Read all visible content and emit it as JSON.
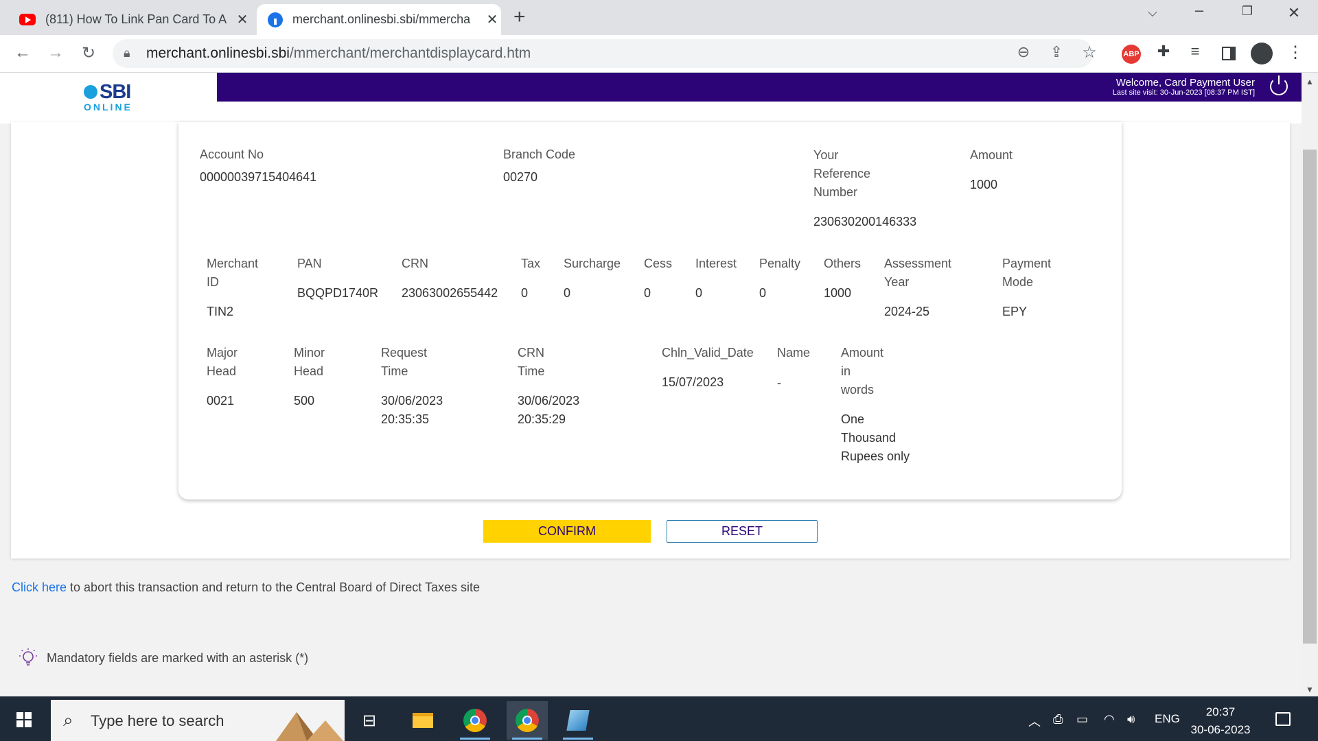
{
  "browser": {
    "tabs": [
      {
        "title": "(811) How To Link Pan Card To A",
        "active": false,
        "icon": "youtube-icon"
      },
      {
        "title": "merchant.onlinesbi.sbi/mmercha",
        "active": true,
        "icon": "sbi-favicon-icon"
      }
    ],
    "new_tab": "+",
    "url_host": "merchant.onlinesbi.sbi",
    "url_path": "/mmerchant/merchantdisplaycard.htm"
  },
  "header": {
    "logo_text": "SBI",
    "logo_sub": "ONLINE",
    "welcome": "Welcome, Card Payment User",
    "last_visit": "Last site visit: 30-Jun-2023 [08:37 PM IST]"
  },
  "details": {
    "account_no_label": "Account No",
    "account_no": "00000039715404641",
    "branch_code_label": "Branch Code",
    "branch_code": "00270",
    "reference_label_1": "Your",
    "reference_label_2": "Reference",
    "reference_label_3": "Number",
    "reference_number": "230630200146333",
    "amount_label": "Amount",
    "amount": "1000"
  },
  "row2": {
    "merchant_id_label_1": "Merchant",
    "merchant_id_label_2": "ID",
    "merchant_id": "TIN2",
    "pan_label": "PAN",
    "pan": "BQQPD1740R",
    "crn_label": "CRN",
    "crn": "23063002655442",
    "tax_label": "Tax",
    "tax": "0",
    "surcharge_label": "Surcharge",
    "surcharge": "0",
    "cess_label": "Cess",
    "cess": "0",
    "interest_label": "Interest",
    "interest": "0",
    "penalty_label": "Penalty",
    "penalty": "0",
    "others_label": "Others",
    "others": "1000",
    "assessment_label_1": "Assessment",
    "assessment_label_2": "Year",
    "assessment_year": "2024-25",
    "payment_mode_label_1": "Payment",
    "payment_mode_label_2": "Mode",
    "payment_mode": "EPY"
  },
  "row3": {
    "major_head_label_1": "Major",
    "major_head_label_2": "Head",
    "major_head": "0021",
    "minor_head_label_1": "Minor",
    "minor_head_label_2": "Head",
    "minor_head": "500",
    "request_time_label_1": "Request",
    "request_time_label_2": "Time",
    "request_date": "30/06/2023",
    "request_time": "20:35:35",
    "crn_time_label_1": "CRN",
    "crn_time_label_2": "Time",
    "crn_date": "30/06/2023",
    "crn_time": "20:35:29",
    "chln_label": "Chln_Valid_Date",
    "chln_date": "15/07/2023",
    "name_label": "Name",
    "name": "-",
    "words_label_1": "Amount",
    "words_label_2": "in",
    "words_label_3": "words",
    "words_1": "One",
    "words_2": "Thousand",
    "words_3": "Rupees only"
  },
  "actions": {
    "confirm": "CONFIRM",
    "reset": "RESET"
  },
  "footer": {
    "abort_link": "Click here",
    "abort_text": " to abort this transaction and return to the Central Board of Direct Taxes site",
    "mandatory_note": "Mandatory fields are marked with an asterisk (*)"
  },
  "taskbar": {
    "search_placeholder": "Type here to search",
    "language": "ENG",
    "time": "20:37",
    "date": "30-06-2023"
  },
  "colors": {
    "header_purple": "#2c0478",
    "confirm_yellow": "#ffd200",
    "link_blue": "#1a73e8"
  }
}
